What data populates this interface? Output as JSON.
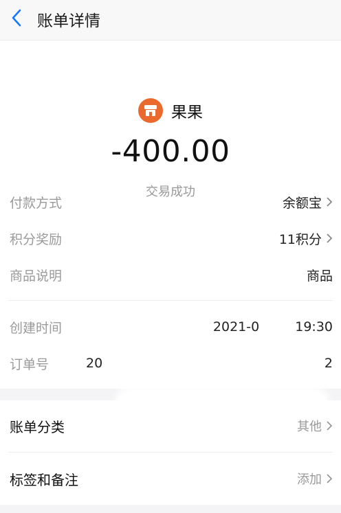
{
  "header": {
    "title": "账单详情"
  },
  "merchant": {
    "name": "果果",
    "icon": "store-icon",
    "icon_color": "#ea6a2d"
  },
  "transaction": {
    "amount": "-400.00",
    "status": "交易成功"
  },
  "details": [
    {
      "label": "付款方式",
      "value": "余额宝",
      "chevron": true
    },
    {
      "label": "积分奖励",
      "value": "11积分",
      "chevron": true
    },
    {
      "label": "商品说明",
      "value": "商品",
      "chevron": false
    }
  ],
  "meta": [
    {
      "label": "创建时间",
      "value_start": "2021-0",
      "value_end": "19:30"
    },
    {
      "label": "订单号",
      "value_start": "20",
      "value_end": "2"
    }
  ],
  "actions": [
    {
      "label": "账单分类",
      "value": "其他"
    },
    {
      "label": "标签和备注",
      "value": "添加"
    }
  ],
  "colors": {
    "accent_blue": "#1677ff"
  }
}
